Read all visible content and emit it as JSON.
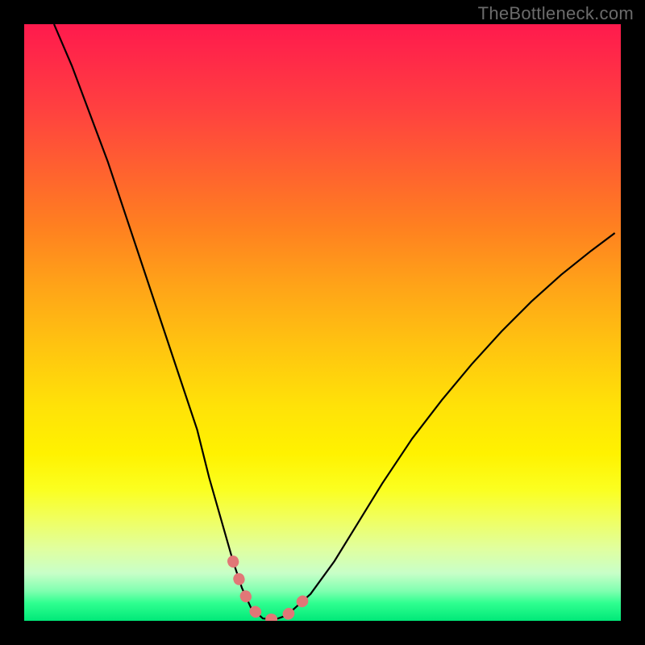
{
  "watermark": "TheBottleneck.com",
  "chart_data": {
    "type": "line",
    "title": "",
    "xlabel": "",
    "ylabel": "",
    "xlim": [
      0,
      100
    ],
    "ylim": [
      0,
      100
    ],
    "grid": false,
    "series": [
      {
        "name": "bottleneck-curve",
        "stroke": "#000000",
        "x": [
          5,
          8,
          11,
          14,
          17,
          20,
          23,
          26,
          29,
          31,
          33,
          35,
          36.5,
          38,
          40,
          42,
          44,
          48,
          52,
          56,
          60,
          65,
          70,
          75,
          80,
          85,
          90,
          95,
          99
        ],
        "values": [
          100,
          93,
          85,
          77,
          68,
          59,
          50,
          41,
          32,
          24,
          17,
          10,
          5.5,
          2.2,
          0.4,
          0.2,
          0.9,
          4.5,
          10,
          16.5,
          23,
          30.5,
          37,
          43,
          48.5,
          53.5,
          58,
          62,
          65
        ]
      }
    ],
    "highlight_segment": {
      "name": "valley-marker",
      "stroke": "#e17777",
      "points_index_range": [
        11,
        17
      ],
      "description": "thick dotted pink-red segment along the curve bottom (valley region)"
    },
    "background_gradient": {
      "top_color": "#ff1a4d",
      "mid_color": "#ffe000",
      "bottom_color": "#00e878"
    }
  }
}
